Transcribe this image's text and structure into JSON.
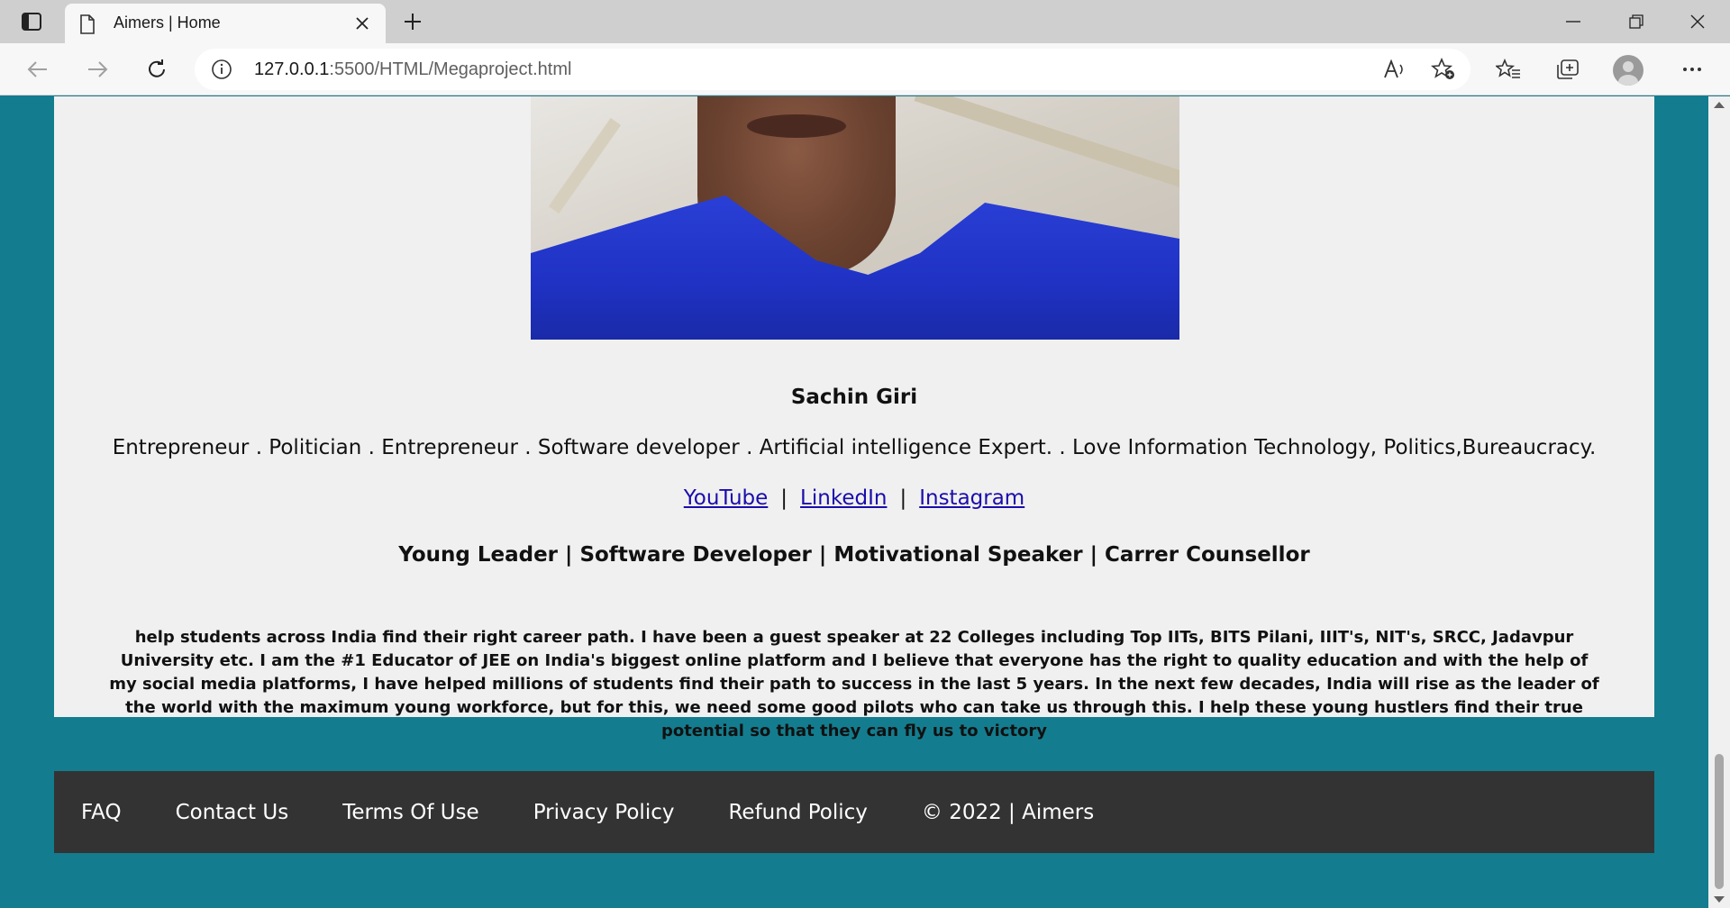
{
  "browser": {
    "tab_title": "Aimers | Home",
    "url_host": "127.0.0.1",
    "url_path": ":5500/HTML/Megaproject.html",
    "icons": [
      "sidebar-icon",
      "page-icon",
      "close-icon",
      "plus-icon",
      "minimize-icon",
      "restore-icon",
      "window-close-icon",
      "back-icon",
      "forward-icon",
      "refresh-icon",
      "info-icon",
      "read-aloud-icon",
      "add-favorite-icon",
      "favorites-icon",
      "collections-icon",
      "profile-icon",
      "more-icon"
    ]
  },
  "profile": {
    "name": "Sachin Giri",
    "roles": "Entrepreneur . Politician . Entrepreneur . Software developer . Artificial intelligence Expert. . Love Information Technology, Politics,Bureaucracy.",
    "links": [
      {
        "label": "YouTube"
      },
      {
        "label": "LinkedIn"
      },
      {
        "label": "Instagram"
      }
    ],
    "separator": "|",
    "tagline": "Young Leader | Software Developer | Motivational Speaker | Carrer Counsellor",
    "bio": "help students across India find their right career path. I have been a guest speaker at 22 Colleges including Top IITs, BITS Pilani, IIIT's, NIT's, SRCC, Jadavpur University etc. I am the #1 Educator of JEE on India's biggest online platform and I believe that everyone has the right to quality education and with the help of my social media platforms, I have helped millions of students find their path to success in the last 5 years. In the next few decades, India will rise as the leader of the world with the maximum young workforce, but for this, we need some good pilots who can take us through this. I help these young hustlers find their true potential so that they can fly us to victory"
  },
  "footer": {
    "links": [
      "FAQ",
      "Contact Us",
      "Terms Of Use",
      "Privacy Policy",
      "Refund Policy"
    ],
    "copyright": "© 2022 | Aimers"
  },
  "colors": {
    "page_background": "#137d8f",
    "card_background": "#f0f0f0",
    "footer_background": "#333333",
    "link": "#1a0dab"
  }
}
